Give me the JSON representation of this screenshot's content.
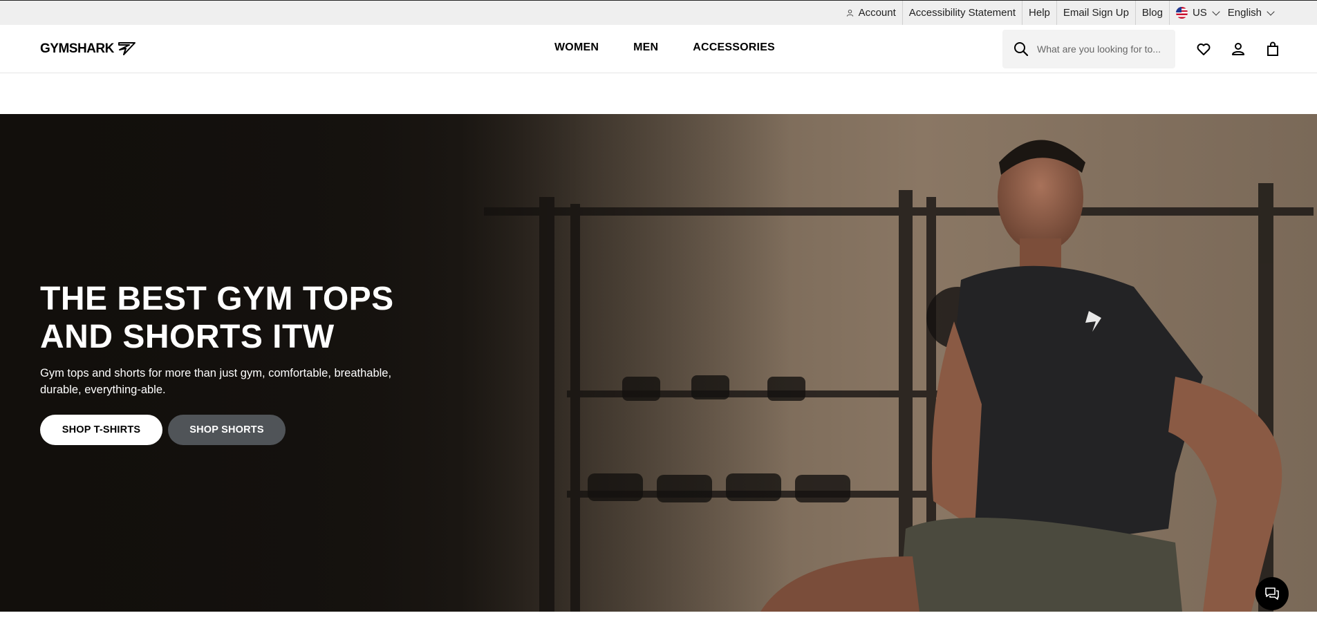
{
  "topbar": {
    "account": "Account",
    "accessibility": "Accessibility Statement",
    "help": "Help",
    "email_signup": "Email Sign Up",
    "blog": "Blog",
    "region": "US",
    "language": "English"
  },
  "header": {
    "logo_text": "GYMSHARK",
    "nav": [
      "WOMEN",
      "MEN",
      "ACCESSORIES"
    ],
    "search_placeholder": "What are you looking for to..."
  },
  "hero": {
    "title_line1": "THE BEST GYM TOPS",
    "title_line2": "AND SHORTS ITW",
    "subtitle": "Gym tops and shorts for more than just gym, comfortable, breathable, durable, everything-able.",
    "primary_cta": "SHOP T-SHIRTS",
    "secondary_cta": "SHOP SHORTS"
  },
  "icons": {
    "account": "person-icon",
    "search": "search-icon",
    "wishlist": "heart-icon",
    "profile": "user-icon",
    "bag": "bag-icon",
    "chat": "chat-icon"
  },
  "colors": {
    "topbar_bg": "#efefef",
    "secondary_button": "#505458",
    "hero_dark": "#1a1714"
  }
}
